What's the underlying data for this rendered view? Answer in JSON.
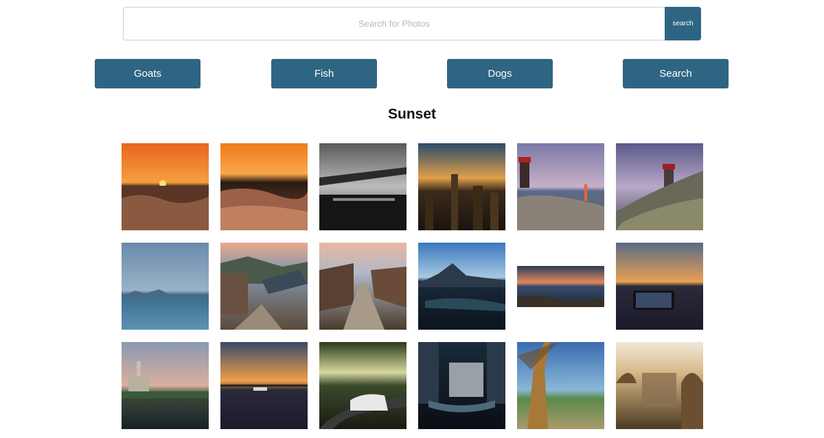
{
  "search": {
    "placeholder": "Search for Photos",
    "button_label": "search"
  },
  "nav": {
    "buttons": [
      {
        "label": "Goats"
      },
      {
        "label": "Fish"
      },
      {
        "label": "Dogs"
      },
      {
        "label": "Search"
      }
    ]
  },
  "page_title": "Sunset",
  "colors": {
    "accent": "#2e6583"
  }
}
